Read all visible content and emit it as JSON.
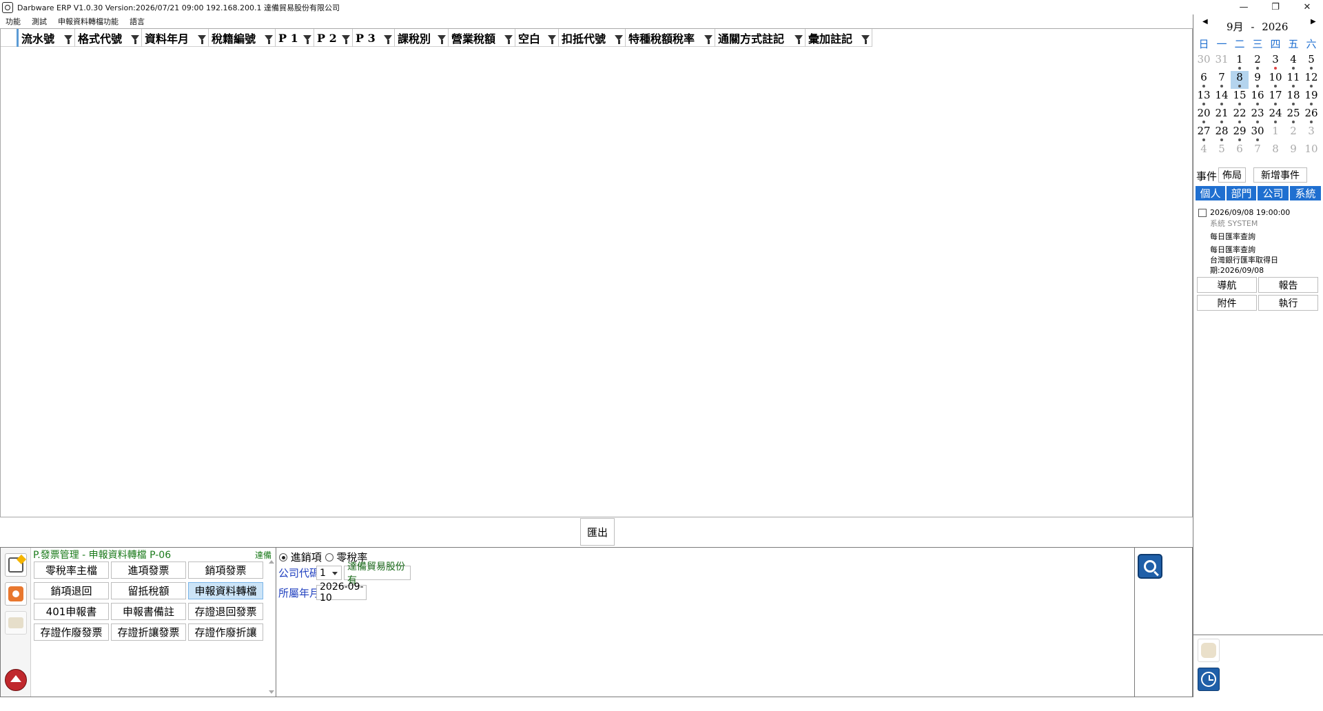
{
  "window": {
    "title": "Darbware ERP V1.0.30 Version:2026/07/21 09:00   192.168.200.1 達備貿易股份有限公司",
    "controls": {
      "minimize": "—",
      "maximize": "❐",
      "close": "✕"
    }
  },
  "menubar": {
    "items": [
      "功能",
      "測試",
      "申報資料轉檔功能",
      "語言"
    ]
  },
  "grid": {
    "columns": [
      "流水號",
      "格式代號",
      "資料年月",
      "稅籍編號",
      "P 1",
      "P 2",
      "P 3",
      "課稅別",
      "營業稅額",
      "空白",
      "扣抵代號",
      "特種稅額稅率",
      "通關方式註記",
      "彙加註記"
    ]
  },
  "export_label": "匯出",
  "menu_panel": {
    "title": "P.發票管理 - 申報資料轉檔  P-06",
    "tag": "達備",
    "buttons": [
      [
        "零稅率主檔",
        "進項發票",
        "銷項發票"
      ],
      [
        "銷項退回",
        "留抵稅額",
        "申報資料轉檔"
      ],
      [
        "401申報書",
        "申報書備註",
        "存證退回發票"
      ],
      [
        "存證作廢發票",
        "存證折讓發票",
        "存證作廢折讓"
      ]
    ],
    "active": "申報資料轉檔"
  },
  "form": {
    "radio_options": [
      "進銷項",
      "零稅率"
    ],
    "selected_radio": "進銷項",
    "company_code_label": "公司代碼",
    "company_code_value": "1",
    "company_name": "達備貿易股份有",
    "period_label": "所屬年月",
    "period_value": "2026-09-10"
  },
  "calendar": {
    "month_label": "9月",
    "separator": "-",
    "year_label": "2026",
    "weekdays": [
      "日",
      "一",
      "二",
      "三",
      "四",
      "五",
      "六"
    ],
    "weeks": [
      [
        "30",
        "31",
        "1",
        "2",
        "3",
        "4",
        "5"
      ],
      [
        "6",
        "7",
        "8",
        "9",
        "10",
        "11",
        "12"
      ],
      [
        "13",
        "14",
        "15",
        "16",
        "17",
        "18",
        "19"
      ],
      [
        "20",
        "21",
        "22",
        "23",
        "24",
        "25",
        "26"
      ],
      [
        "27",
        "28",
        "29",
        "30",
        "1",
        "2",
        "3"
      ],
      [
        "4",
        "5",
        "6",
        "7",
        "8",
        "9",
        "10"
      ]
    ],
    "selected_day": "8"
  },
  "events": {
    "label": "事件",
    "layout_button": "佈局",
    "add_button": "新增事件",
    "tabs": [
      "個人",
      "部門",
      "公司",
      "系統"
    ],
    "item": {
      "datetime": "2026/09/08 19:00:00",
      "source": "系統  SYSTEM",
      "title": "每日匯率查詢",
      "desc_lines": [
        "每日匯率查詢",
        "台灣銀行匯率取得日",
        "期:2026/09/08"
      ]
    },
    "actions": [
      "導航",
      "報告",
      "附件",
      "執行"
    ]
  },
  "colors": {
    "accent": "#1f6fd0",
    "menu_title": "#1a7a1a",
    "form_label": "#1f3fbf"
  }
}
